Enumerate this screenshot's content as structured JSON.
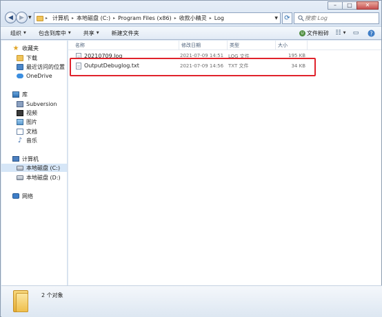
{
  "window": {
    "minimize_glyph": "–",
    "maximize_glyph": "□",
    "close_glyph": "✕"
  },
  "address": {
    "crumbs": [
      "计算机",
      "本地磁盘 (C:)",
      "Program Files (x86)",
      "收款小精灵",
      "Log"
    ],
    "separator": "▸"
  },
  "search": {
    "placeholder": "搜索 Log"
  },
  "toolbar": {
    "organize": "组织",
    "include_in_library": "包含到库中",
    "share": "共享",
    "new_folder": "新建文件夹",
    "file_shredder": "文件粉碎",
    "caret": "▼"
  },
  "sidebar": {
    "favorites": "收藏夹",
    "downloads": "下载",
    "recent": "最近访问的位置",
    "onedrive": "OneDrive",
    "libraries": "库",
    "subversion": "Subversion",
    "videos": "视频",
    "pictures": "图片",
    "documents": "文档",
    "music": "音乐",
    "computer": "计算机",
    "drive_c": "本地磁盘 (C:)",
    "drive_d": "本地磁盘 (D:)",
    "network": "网络"
  },
  "columns": {
    "name": "名称",
    "modified": "修改日期",
    "type": "类型",
    "size": "大小"
  },
  "files": [
    {
      "name": "20210709.log",
      "modified": "2021-07-09 14:51",
      "type": "LOG 文件",
      "size": "195 KB"
    },
    {
      "name": "OutputDebuglog.txt",
      "modified": "2021-07-09 14:56",
      "type": "TXT 文件",
      "size": "34 KB"
    }
  ],
  "status": {
    "item_count": "2 个对象"
  },
  "colors": {
    "highlight_box": "#e0222b",
    "selected_nav": "#d6e6f7"
  }
}
